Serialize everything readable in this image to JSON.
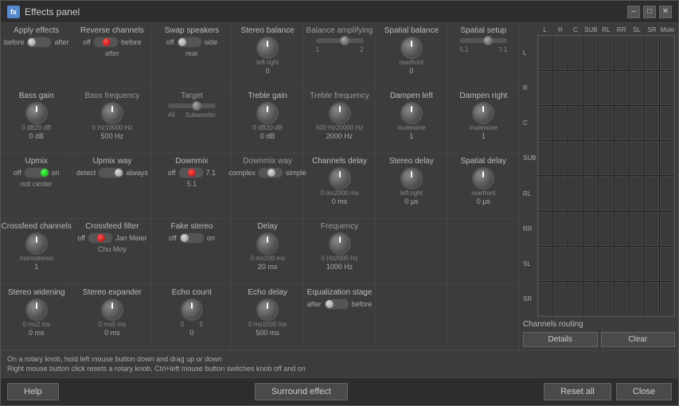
{
  "window": {
    "title": "Effects panel",
    "icon": "fx",
    "min_btn": "–",
    "max_btn": "□",
    "close_btn": "✕"
  },
  "rows": [
    {
      "cols": [
        {
          "id": "apply-effects",
          "label": "Apply effects",
          "sublabel": "",
          "control": "toggle-lr",
          "toggle_left": "before",
          "toggle_right": "after",
          "thumb": "left"
        },
        {
          "id": "reverse-channels",
          "label": "Reverse channels",
          "sublabel": "",
          "control": "toggle-lr",
          "toggle_left": "off",
          "toggle_right": "before",
          "toggle_bottom": "after",
          "thumb": "center",
          "active": true
        },
        {
          "id": "swap-speakers",
          "label": "Swap speakers",
          "sublabel": "",
          "control": "toggle-lr",
          "toggle_left": "off",
          "toggle_right": "side",
          "toggle_bottom": "rear",
          "thumb": "left",
          "active": false
        },
        {
          "id": "stereo-balance",
          "label": "Stereo balance",
          "control": "knob",
          "range_left": "left",
          "range_right": "right",
          "value": "0"
        },
        {
          "id": "balance-amplifying",
          "label": "Balance amplifying",
          "control": "slider",
          "range_left": "1",
          "range_right": "2",
          "value": ""
        },
        {
          "id": "spatial-balance",
          "label": "Spatial balance",
          "control": "knob",
          "range_left": "rear",
          "range_right": "front",
          "value": "0"
        },
        {
          "id": "spatial-setup",
          "label": "Spatial setup",
          "control": "slider",
          "range_left": "5.1",
          "range_right": "7.1",
          "value": ""
        }
      ]
    },
    {
      "cols": [
        {
          "id": "bass-gain",
          "label": "Bass gain",
          "control": "knob",
          "range_left": "0 dB",
          "range_right": "20 dB",
          "value": "0 dB"
        },
        {
          "id": "bass-frequency",
          "label": "Bass frequency",
          "control": "knob",
          "range_left": "0 Hz",
          "range_right": "10000 Hz",
          "value": "500 Hz"
        },
        {
          "id": "target",
          "label": "Target",
          "control": "slider-named",
          "range_left": "All",
          "range_right": "Subwoofer",
          "value": ""
        },
        {
          "id": "treble-gain",
          "label": "Treble gain",
          "control": "knob",
          "range_left": "0 dB",
          "range_right": "20 dB",
          "value": "0 dB"
        },
        {
          "id": "treble-frequency",
          "label": "Treble frequency",
          "control": "knob",
          "range_left": "500 Hz",
          "range_right": "20000 Hz",
          "value": "2000 Hz"
        },
        {
          "id": "dampen-left",
          "label": "Dampen left",
          "control": "knob",
          "range_left": "mute",
          "range_right": "none",
          "value": "1"
        },
        {
          "id": "dampen-right",
          "label": "Dampen right",
          "control": "knob",
          "range_left": "mute",
          "range_right": "none",
          "value": "1"
        }
      ]
    },
    {
      "cols": [
        {
          "id": "upmix",
          "label": "Upmix",
          "control": "toggle-lr",
          "toggle_left": "off",
          "toggle_right": "on",
          "thumb": "right",
          "green": true,
          "sublabel": "not center"
        },
        {
          "id": "upmix-way",
          "label": "Upmix way",
          "control": "toggle-lr",
          "toggle_left": "detect",
          "toggle_right": "always",
          "thumb": "right"
        },
        {
          "id": "downmix",
          "label": "Downmix",
          "control": "toggle-lr",
          "toggle_left": "off",
          "toggle_right": "7.1",
          "toggle_bottom": "5.1",
          "thumb": "center",
          "active": true
        },
        {
          "id": "downmix-way",
          "label": "Downmix way",
          "control": "toggle-lr",
          "toggle_left": "complex",
          "toggle_right": "simple",
          "thumb": "center"
        },
        {
          "id": "channels-delay",
          "label": "Channels delay",
          "control": "knob",
          "range_left": "0 ms",
          "range_right": "2000 ms",
          "value": "0 ms"
        },
        {
          "id": "stereo-delay",
          "label": "Stereo delay",
          "control": "knob",
          "range_left": "left",
          "range_right": "right",
          "value": "0 μs"
        },
        {
          "id": "spatial-delay",
          "label": "Spatial delay",
          "control": "knob",
          "range_left": "rear",
          "range_right": "front",
          "value": "0 μs"
        }
      ]
    },
    {
      "cols": [
        {
          "id": "crossfeed-channels",
          "label": "Crossfeed channels",
          "control": "knob",
          "range_left": "mono",
          "range_right": "stereo",
          "value": "1"
        },
        {
          "id": "crossfeed-filter",
          "label": "Crossfeed filter",
          "control": "toggle-named",
          "toggle_left": "off",
          "toggle_right": "Jan Meier",
          "toggle_bottom": "Chu Moy",
          "thumb": "center",
          "active": true
        },
        {
          "id": "fake-stereo",
          "label": "Fake stereo",
          "control": "toggle-lr",
          "toggle_left": "off",
          "toggle_right": "on",
          "thumb": "left",
          "active": false
        },
        {
          "id": "delay",
          "label": "Delay",
          "control": "knob",
          "range_left": "0 ms",
          "range_right": "100 ms",
          "value": "20 ms"
        },
        {
          "id": "frequency",
          "label": "Frequency",
          "control": "knob",
          "range_left": "0 Hz",
          "range_right": "2000 Hz",
          "value": "1000 Hz"
        }
      ]
    },
    {
      "cols": [
        {
          "id": "stereo-widening",
          "label": "Stereo widening",
          "control": "knob",
          "range_left": "0 ms",
          "range_right": "2 ms",
          "value": "0 ms"
        },
        {
          "id": "stereo-expander",
          "label": "Stereo expander",
          "control": "knob",
          "range_left": "0 ms",
          "range_right": "5 ms",
          "value": "0 ms"
        },
        {
          "id": "echo-count",
          "label": "Echo count",
          "control": "knob",
          "range_left": "0",
          "range_right": "5",
          "value": "0"
        },
        {
          "id": "echo-delay",
          "label": "Echo delay",
          "control": "knob",
          "range_left": "0 ms",
          "range_right": "1000 ms",
          "value": "500 ms"
        },
        {
          "id": "equalization-stage",
          "label": "Equalization stage",
          "control": "toggle-lr",
          "toggle_left": "after",
          "toggle_right": "before",
          "thumb": "left"
        }
      ]
    }
  ],
  "routing": {
    "title": "Channels routing",
    "col_headers": [
      "L",
      "R",
      "C",
      "SUB",
      "RL",
      "RR",
      "SL",
      "SR",
      "Mute"
    ],
    "row_headers": [
      "L",
      "R",
      "C",
      "SUB",
      "RL",
      "RR",
      "SL",
      "SR"
    ],
    "details_btn": "Details",
    "clear_btn": "Clear"
  },
  "status": {
    "line1": "On a rotary knob, hold left mouse button down and drag up or down",
    "line2": "Right mouse button click resets a rotary knob, Ctrl+left mouse button switches knob off and on"
  },
  "footer": {
    "help_btn": "Help",
    "surround_btn": "Surround effect",
    "reset_btn": "Reset all",
    "close_btn": "Close"
  }
}
